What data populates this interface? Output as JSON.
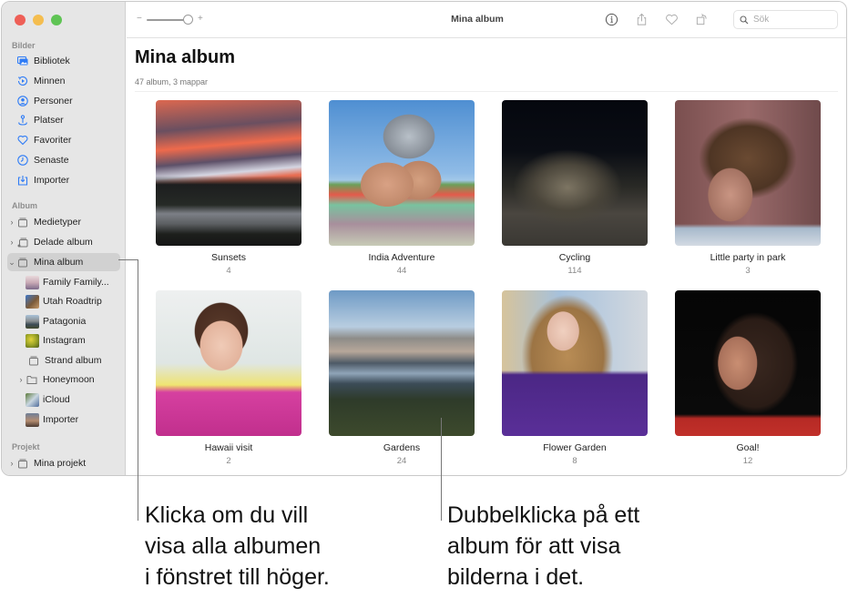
{
  "window": {
    "title": "Mina album",
    "search": {
      "placeholder": "Sök"
    },
    "toolbar_icons": [
      "info-icon",
      "share-icon",
      "heart-icon",
      "rotate-icon"
    ]
  },
  "sidebar": {
    "sections": [
      {
        "label": "Bilder",
        "items": [
          {
            "label": "Bibliotek",
            "icon": "library-icon"
          },
          {
            "label": "Minnen",
            "icon": "memories-icon"
          },
          {
            "label": "Personer",
            "icon": "people-icon"
          },
          {
            "label": "Platser",
            "icon": "places-icon"
          },
          {
            "label": "Favoriter",
            "icon": "heart-icon"
          },
          {
            "label": "Senaste",
            "icon": "clock-icon"
          },
          {
            "label": "Importer",
            "icon": "import-icon"
          }
        ]
      },
      {
        "label": "Album",
        "items": [
          {
            "label": "Medietyper",
            "icon": "album-stack-icon",
            "disclosure": "collapsed"
          },
          {
            "label": "Delade album",
            "icon": "shared-album-icon",
            "disclosure": "collapsed"
          },
          {
            "label": "Mina album",
            "icon": "album-stack-icon",
            "disclosure": "expanded",
            "selected": true
          },
          {
            "label": "Family Family...",
            "thumb": true
          },
          {
            "label": "Utah Roadtrip",
            "thumb": true
          },
          {
            "label": "Patagonia",
            "thumb": true
          },
          {
            "label": "Instagram",
            "thumb": true
          },
          {
            "label": "Strand album",
            "icon": "album-stack-icon"
          },
          {
            "label": "Honeymoon",
            "icon": "folder-icon",
            "disclosure": "collapsed"
          },
          {
            "label": "iCloud",
            "thumb": true
          },
          {
            "label": "Importer",
            "thumb": true
          }
        ]
      },
      {
        "label": "Projekt",
        "items": [
          {
            "label": "Mina projekt",
            "icon": "album-stack-icon",
            "disclosure": "collapsed"
          }
        ]
      }
    ]
  },
  "main": {
    "title": "Mina album",
    "subtitle": "47 album, 3 mappar",
    "albums": [
      {
        "name": "Sunsets",
        "count": "4"
      },
      {
        "name": "India Adventure",
        "count": "44"
      },
      {
        "name": "Cycling",
        "count": "114"
      },
      {
        "name": "Little party in park",
        "count": "3"
      },
      {
        "name": "Hawaii visit",
        "count": "2"
      },
      {
        "name": "Gardens",
        "count": "24"
      },
      {
        "name": "Flower Garden",
        "count": "8"
      },
      {
        "name": "Goal!",
        "count": "12"
      }
    ]
  },
  "callouts": [
    {
      "lines": [
        "Klicka om du vill",
        "visa alla albumen",
        "i fönstret till höger."
      ]
    },
    {
      "lines": [
        "Dubbelklicka på ett",
        "album för att visa",
        "bilderna i det."
      ]
    }
  ],
  "colors": {
    "accent": "#2f7cf6",
    "sidebar_bg": "#e6e6e6",
    "selected_bg": "#d1d1d1"
  }
}
